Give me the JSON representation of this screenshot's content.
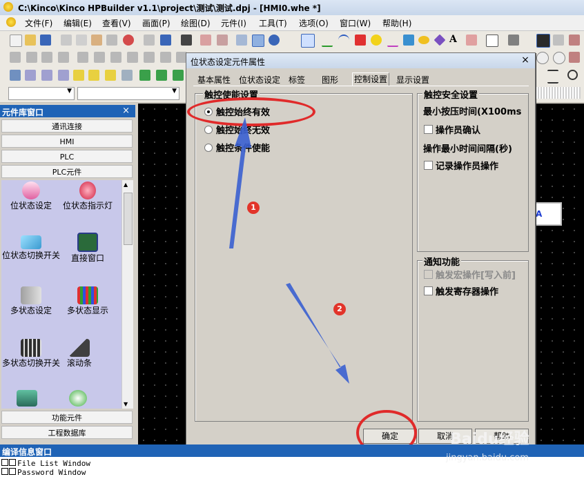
{
  "window": {
    "title": "C:\\Kinco\\Kinco HPBuilder v1.1\\project\\测试\\测试.dpj - [HMI0.whe *]"
  },
  "menu": [
    "文件(F)",
    "编辑(E)",
    "查看(V)",
    "画面(P)",
    "绘图(D)",
    "元件(I)",
    "工具(T)",
    "选项(O)",
    "窗口(W)",
    "帮助(H)"
  ],
  "left_panel": {
    "title": "元件库窗口",
    "close": "×",
    "categories": [
      "通讯连接",
      "HMI",
      "PLC",
      "PLC元件"
    ],
    "items": [
      {
        "label": "位状态设定",
        "icon": "bit-set-icon"
      },
      {
        "label": "位状态指示灯",
        "icon": "bit-lamp-icon"
      },
      {
        "label": "位状态切换开关",
        "icon": "bit-switch-icon"
      },
      {
        "label": "直接窗口",
        "icon": "direct-window-icon"
      },
      {
        "label": "多状态设定",
        "icon": "multi-set-icon"
      },
      {
        "label": "多状态显示",
        "icon": "multi-display-icon"
      },
      {
        "label": "多状态切换开关",
        "icon": "multi-switch-icon"
      },
      {
        "label": "滚动条",
        "icon": "scrollbar-icon"
      }
    ],
    "bottom": [
      "功能元件",
      "工程数据库"
    ]
  },
  "canvas": {
    "widget_text": "A"
  },
  "dialog": {
    "title": "位状态设定元件属性",
    "close": "×",
    "tabs": [
      "基本属性",
      "位状态设定",
      "标签",
      "图形",
      "控制设置",
      "显示设置"
    ],
    "active_tab": "控制设置",
    "enable_group": {
      "label": "触控使能设置",
      "options": [
        "触控始终有效",
        "触控始终无效",
        "触控条件使能"
      ],
      "selected": "触控始终有效"
    },
    "safety_group": {
      "label": "触控安全设置",
      "min_press": "最小按压时间(X100ms",
      "operator_confirm": "操作员确认",
      "min_interval": "操作最小时间间隔(秒)",
      "log_operator": "记录操作员操作"
    },
    "notify_group": {
      "label": "通知功能",
      "macro": "触发宏操作[写入前]",
      "register": "触发寄存器操作"
    },
    "buttons": {
      "ok": "确定",
      "cancel": "取消",
      "help": "帮助"
    }
  },
  "annotations": {
    "badge1": "1",
    "badge2": "2",
    "annotation_color": "#e02a2a",
    "arrow_color": "#3a5fd0"
  },
  "compile_panel": {
    "title": "编译信息窗口",
    "lines": [
      "File List Window",
      "Password Window"
    ]
  },
  "watermark": {
    "line1": "Baidu经验",
    "line2": "jingyan.baidu.com"
  }
}
